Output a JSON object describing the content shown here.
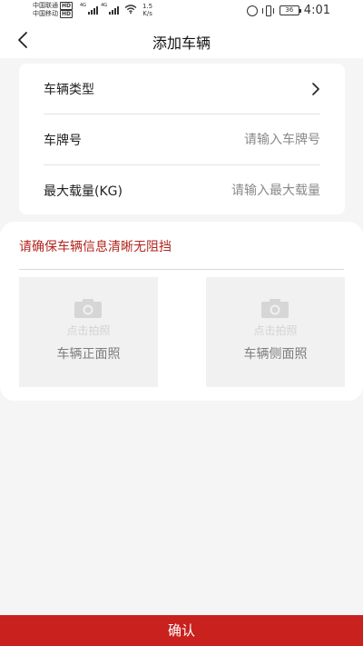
{
  "status_bar": {
    "carrier_1": "中国联通",
    "carrier_2": "中国移动",
    "hd_badge": "HD",
    "network_type": "4G",
    "speed_value": "1.5",
    "speed_unit": "K/s",
    "battery": "36",
    "time": "4:01"
  },
  "nav": {
    "back_icon": "chevron-left-icon",
    "title": "添加车辆"
  },
  "form": {
    "vehicle_type_label": "车辆类型",
    "plate_label": "车牌号",
    "plate_placeholder": "请输入车牌号",
    "max_load_label": "最大载量(KG)",
    "max_load_placeholder": "请输入最大载量"
  },
  "photos": {
    "notice": "请确保车辆信息清晰无阻挡",
    "slots": [
      {
        "hint": "点击拍照",
        "label": "车辆正面照",
        "icon": "camera-icon"
      },
      {
        "hint": "点击拍照",
        "label": "车辆侧面照",
        "icon": "camera-icon"
      }
    ]
  },
  "confirm_label": "确认",
  "colors": {
    "accent": "#c8211e",
    "notice_text": "#b3261e",
    "page_bg": "#f5f5f5"
  }
}
